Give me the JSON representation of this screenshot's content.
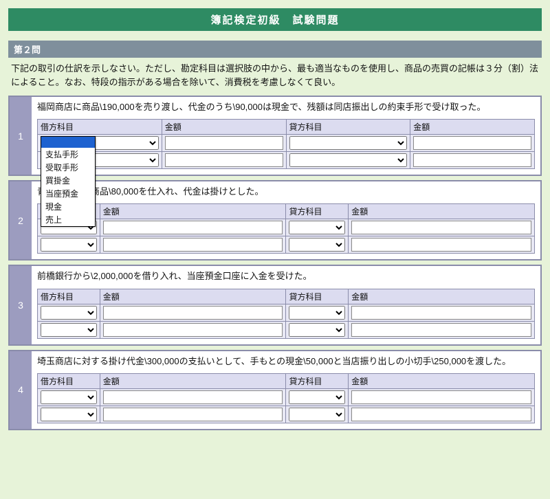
{
  "title": "簿記検定初級　試験問題",
  "section_label": "第２問",
  "instructions": "下記の取引の仕訳を示しなさい。ただし、勘定科目は選択肢の中から、最も適当なものを使用し、商品の売買の記帳は３分（割）法によること。なお、特段の指示がある場合を除いて、消費税を考慮しなくて良い。",
  "columns": {
    "debit_account": "借方科目",
    "debit_amount": "金額",
    "credit_account": "貸方科目",
    "credit_amount": "金額"
  },
  "dropdown_options": [
    "",
    "支払手形",
    "受取手形",
    "買掛金",
    "当座預金",
    "現金",
    "売上"
  ],
  "questions": [
    {
      "num": "1",
      "text": "福岡商店に商品\\190,000を売り渡し、代金のうち\\90,000は現金で、残額は同店振出しの約束手形で受け取った。"
    },
    {
      "num": "2",
      "text": "青森商店から商品\\80,000を仕入れ、代金は掛けとした。"
    },
    {
      "num": "3",
      "text": "前橋銀行から\\2,000,000を借り入れ、当座預金口座に入金を受けた。"
    },
    {
      "num": "4",
      "text": "埼玉商店に対する掛け代金\\300,000の支払いとして、手もとの現金\\50,000と当店振り出しの小切手\\250,000を渡した。"
    }
  ]
}
